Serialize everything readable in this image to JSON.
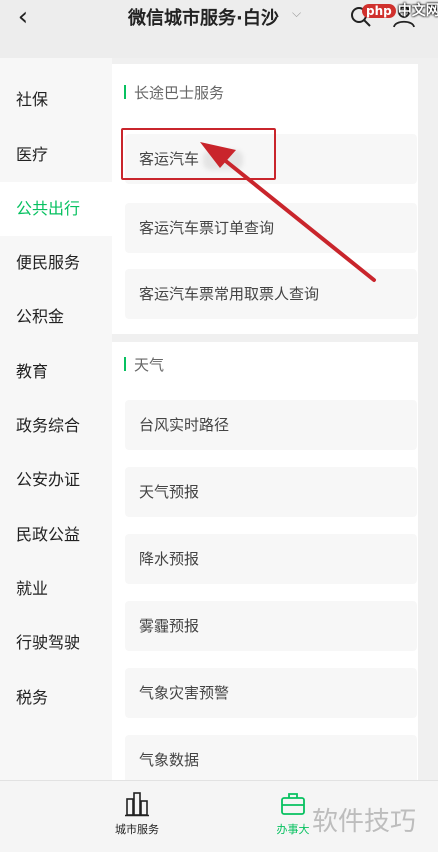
{
  "header": {
    "back_label": "‹",
    "title": "微信城市服务·白沙",
    "caret": "⌵",
    "php_logo_prefix": "php",
    "php_logo_text": "中文网"
  },
  "sidebar": {
    "items": [
      {
        "label": "社保"
      },
      {
        "label": "医疗"
      },
      {
        "label": "公共出行"
      },
      {
        "label": "便民服务"
      },
      {
        "label": "公积金"
      },
      {
        "label": "教育"
      },
      {
        "label": "政务综合"
      },
      {
        "label": "公安办证"
      },
      {
        "label": "民政公益"
      },
      {
        "label": "就业"
      },
      {
        "label": "行驶驾驶"
      },
      {
        "label": "税务"
      }
    ],
    "active_label": "公共出行"
  },
  "sections": [
    {
      "title": "长途巴士服务",
      "cards": [
        {
          "label": "客运汽车"
        },
        {
          "label": "客运汽车票订单查询"
        },
        {
          "label": "客运汽车票常用取票人查询"
        }
      ]
    },
    {
      "title": "天气",
      "cards": [
        {
          "label": "台风实时路径"
        },
        {
          "label": "天气预报"
        },
        {
          "label": "降水预报"
        },
        {
          "label": "雾霾预报"
        },
        {
          "label": "气象灾害预警"
        },
        {
          "label": "气象数据"
        }
      ]
    }
  ],
  "tabbar": {
    "city_label": "城市服务",
    "affairs_label": "办事大"
  },
  "watermark": "软件技巧",
  "colors": {
    "accent": "#07c160",
    "annotation": "#c9252c"
  },
  "icons": {
    "back": "back-arrow-icon",
    "search": "search-icon",
    "person": "person-icon",
    "city": "city-building-icon",
    "affairs": "briefcase-icon"
  }
}
